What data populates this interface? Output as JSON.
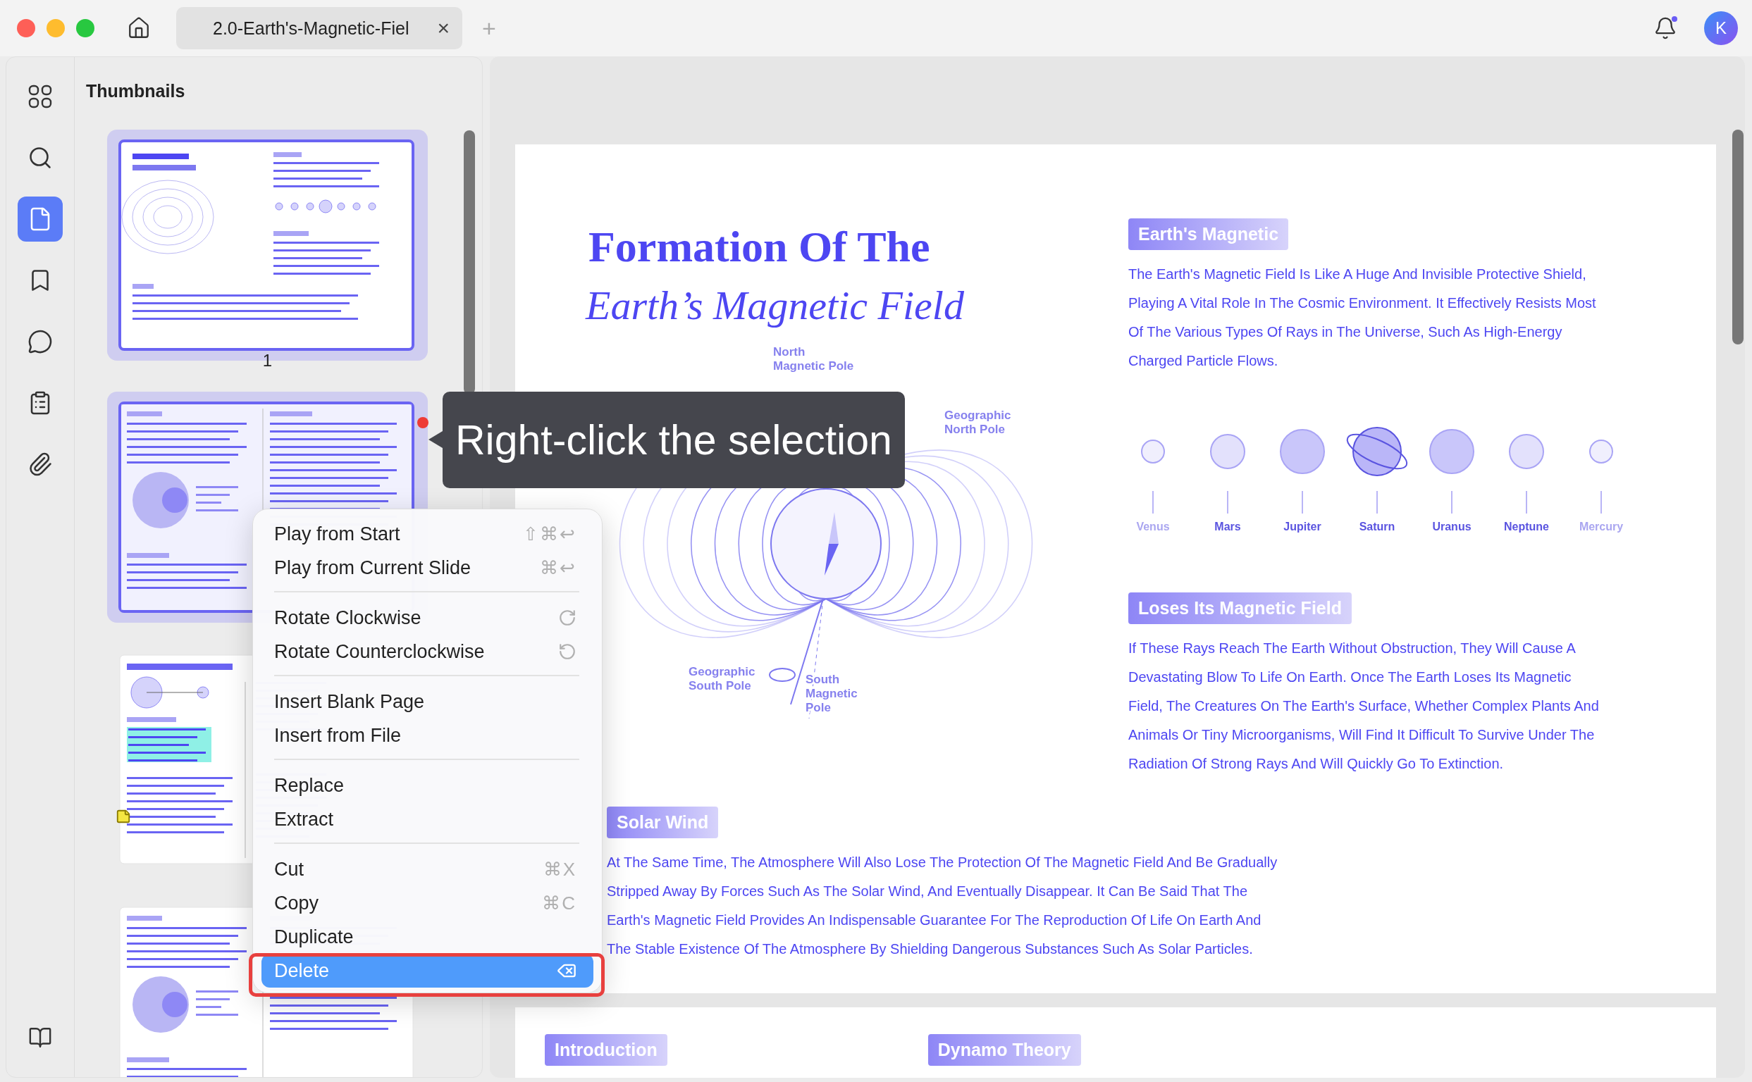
{
  "window": {
    "controls": [
      {
        "color": "#fe5f57"
      },
      {
        "color": "#febc2e"
      },
      {
        "color": "#28c840"
      }
    ]
  },
  "tabs": [
    {
      "label": "2.0-Earth's-Magnetic-Fiel",
      "selected": true,
      "close": "×"
    }
  ],
  "new_tab": "+",
  "notifications": {
    "unread": true
  },
  "avatar": {
    "initial": "K"
  },
  "rail": [
    {
      "kind": "grid",
      "selected": false
    },
    {
      "kind": "search",
      "selected": false
    },
    {
      "kind": "pages",
      "selected": true
    },
    {
      "kind": "bookmark",
      "selected": false
    },
    {
      "kind": "comment",
      "selected": false
    },
    {
      "kind": "form",
      "selected": false
    },
    {
      "kind": "attachment",
      "selected": false
    }
  ],
  "rail_bottom": {
    "kind": "panel"
  },
  "thumbnails": {
    "title": "Thumbnails",
    "pages": [
      {
        "kind": "title-diagram",
        "selected": true,
        "number": "1",
        "note": false
      },
      {
        "kind": "two-column",
        "selected": true,
        "note": false
      },
      {
        "kind": "diagram-left",
        "selected": false,
        "note": true
      },
      {
        "kind": "two-column",
        "selected": false,
        "note": false
      }
    ]
  },
  "tooltip": {
    "text": "Right-click the selection"
  },
  "context_menu": {
    "groups": [
      [
        {
          "label": "Play from Start",
          "shortcut": "⇧⌘↩",
          "selected": false
        },
        {
          "label": "Play from Current Slide",
          "shortcut": "⌘↩",
          "selected": false
        }
      ],
      [
        {
          "label": "Rotate Clockwise",
          "selected": false
        },
        {
          "label": "Rotate Counterclockwise",
          "selected": false
        }
      ],
      [
        {
          "label": "Insert Blank Page",
          "selected": false
        },
        {
          "label": "Insert from File",
          "selected": false
        }
      ],
      [
        {
          "label": "Replace",
          "selected": false
        },
        {
          "label": "Extract",
          "selected": false
        }
      ],
      [
        {
          "label": "Cut",
          "shortcut": "⌘X",
          "selected": false
        },
        {
          "label": "Copy",
          "shortcut": "⌘C",
          "selected": false
        },
        {
          "label": "Duplicate",
          "selected": false
        },
        {
          "label": "Delete",
          "selected": true
        }
      ]
    ]
  },
  "document": {
    "page": {
      "title_line_1": "Formation Of The",
      "title_line_2": "Earth’s Magnetic Field",
      "diagram_labels": {
        "north_magnetic": [
          "North",
          "Magnetic Pole"
        ],
        "geographic_north": [
          "Geographic",
          "North Pole"
        ],
        "geographic_south": [
          "Geographic",
          "South Pole"
        ],
        "south_magnetic": [
          "South",
          "Magnetic",
          "Pole"
        ]
      },
      "sections": [
        {
          "heading": "Earth's Magnetic",
          "lines": [
            "The Earth's Magnetic Field Is Like A Huge And Invisible Protective Shield,",
            "Playing A Vital Role In The Cosmic Environment. It Effectively Resists Most",
            "Of The Various Types Of Rays in The Universe, Such As High-Energy",
            "Charged Particle Flows."
          ]
        },
        {
          "heading": "Loses Its Magnetic Field",
          "lines": [
            "If These Rays Reach The Earth Without Obstruction, They Will Cause A",
            "Devastating Blow To Life On Earth. Once The Earth Loses Its Magnetic",
            "Field, The Creatures On The Earth's Surface, Whether Complex Plants And",
            "Animals Or Tiny Microorganisms, Will Find It Difficult To Survive Under The",
            "Radiation Of Strong Rays And Will Quickly Go To Extinction."
          ]
        }
      ],
      "planets": [
        {
          "name": "Venus",
          "kind": "tiny"
        },
        {
          "name": "Mars",
          "kind": "small"
        },
        {
          "name": "Jupiter",
          "kind": "large"
        },
        {
          "name": "Saturn",
          "kind": "ringed"
        },
        {
          "name": "Uranus",
          "kind": "large"
        },
        {
          "name": "Neptune",
          "kind": "small"
        },
        {
          "name": "Mercury",
          "kind": "tiny"
        }
      ],
      "solar_wind": {
        "heading": "Solar Wind",
        "lines": [
          "At The Same Time, The Atmosphere Will Also Lose The Protection Of The Magnetic Field And Be Gradually",
          "Stripped Away By Forces Such As The Solar Wind, And Eventually Disappear. It Can Be Said That The",
          "Earth's Magnetic Field Provides An Indispensable Guarantee For The Reproduction Of Life On Earth And",
          "The Stable Existence Of The Atmosphere By Shielding Dangerous Substances Such As Solar Particles."
        ]
      }
    },
    "next_page": {
      "headings": [
        "Introduction",
        "Dynamo Theory"
      ]
    }
  }
}
